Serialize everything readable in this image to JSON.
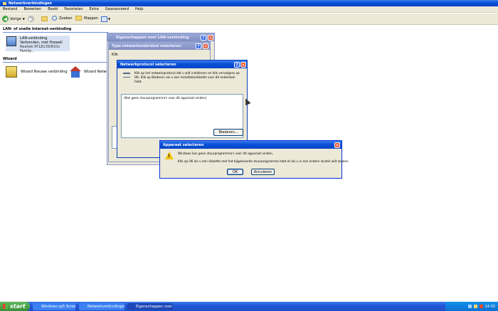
{
  "explorer": {
    "title": "Netwerkverbindingen",
    "menu": [
      "Bestand",
      "Bewerken",
      "Beeld",
      "Favorieten",
      "Extra",
      "Geavanceerd",
      "Help"
    ],
    "toolbar": {
      "back": "Vorige",
      "search": "Zoeken",
      "folders": "Mappen"
    },
    "section_lan": "LAN- of snelle Internet-verbinding",
    "lan_item": {
      "line1": "LAN-verbinding",
      "line2": "Verbonden, met firewall",
      "line3": "Realtek RTL8139/810x Family..."
    },
    "section_wizard": "Wizard",
    "wizard_new": "Wizard Nieuwe verbinding",
    "wizard_network": "Wizard Netwer"
  },
  "props_window": {
    "title": "Eigenschappen voor LAN-verbinding"
  },
  "type_window": {
    "title": "Type netwerkonderdeel selecteren",
    "text": "Klik op het netwerkonderdeel dat u wilt installeren"
  },
  "protocol_window": {
    "title": "Netwerkprotocol selecteren",
    "instructions": "Klik op het netwerkprotocol dat u wilt installeren en klik vervolgens op OK. Klik op Bladeren als u een installatiediskette voor dit onderdeel hebt.",
    "list_text": "(Kan geen stuurprogramma's voor dit apparaat vinden)",
    "browse": "Bladeren..."
  },
  "alert": {
    "title": "Apparaat selecteren",
    "line1": "Windows kan geen stuurprogramma's voor dit apparaat vinden.",
    "line2": "Klik op OK als u een diskette met het bijgeleverde stuurprogramma hebt of als u in een andere locatie wilt zoeken.",
    "ok": "OK",
    "cancel": "Annuleren"
  },
  "taskbar": {
    "start": "start",
    "items": [
      "Windows xp5 Screensh...",
      "Netwerkverbindingen",
      "Eigenschappen voor ..."
    ],
    "clock": "14:33"
  }
}
